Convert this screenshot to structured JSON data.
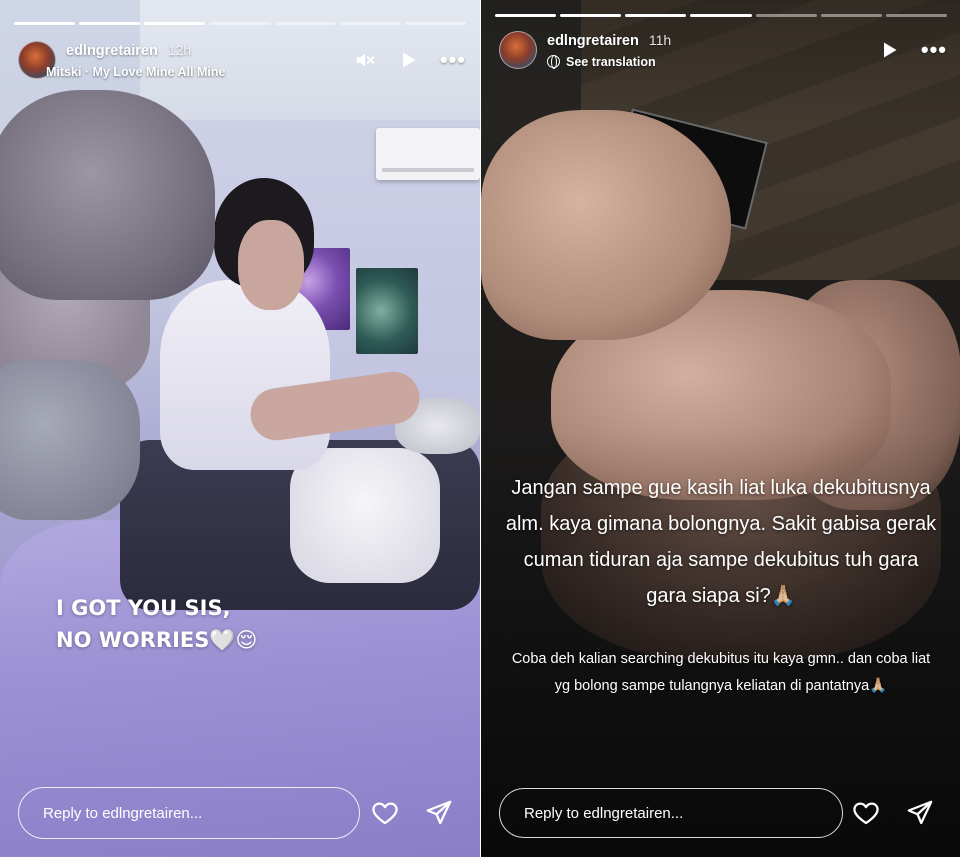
{
  "left_story": {
    "progress": {
      "segments": 7,
      "completed": 3
    },
    "username": "edlngretairen",
    "time_ago": "12h",
    "music": "Mitski · My Love Mine All Mine",
    "sticker_lines": [
      "I GOT YOU SIS,",
      "NO WORRIES🤍😌"
    ],
    "reply_placeholder": "Reply to edlngretairen..."
  },
  "right_story": {
    "progress": {
      "segments": 7,
      "completed": 4
    },
    "username": "edlngretairen",
    "time_ago": "11h",
    "see_translation": "See translation",
    "caption_main": "Jangan sampe gue kasih liat luka dekubitusnya alm. kaya gimana bolongnya. Sakit gabisa gerak cuman tiduran aja sampe dekubitus tuh gara gara siapa si?🙏🏼",
    "caption_sub": "Coba deh kalian searching dekubitus itu kaya gmn.. dan coba liat yg bolong sampe tulangnya keliatan di pantatnya🙏🏼",
    "reply_placeholder": "Reply to edlngretairen..."
  },
  "icons": {
    "mute": "speaker-muted-icon",
    "play": "play-icon",
    "more": "more-options-icon",
    "like": "heart-icon",
    "share": "send-icon"
  },
  "colors": {
    "text": "#ffffff",
    "reply_border": "#ffffff"
  }
}
